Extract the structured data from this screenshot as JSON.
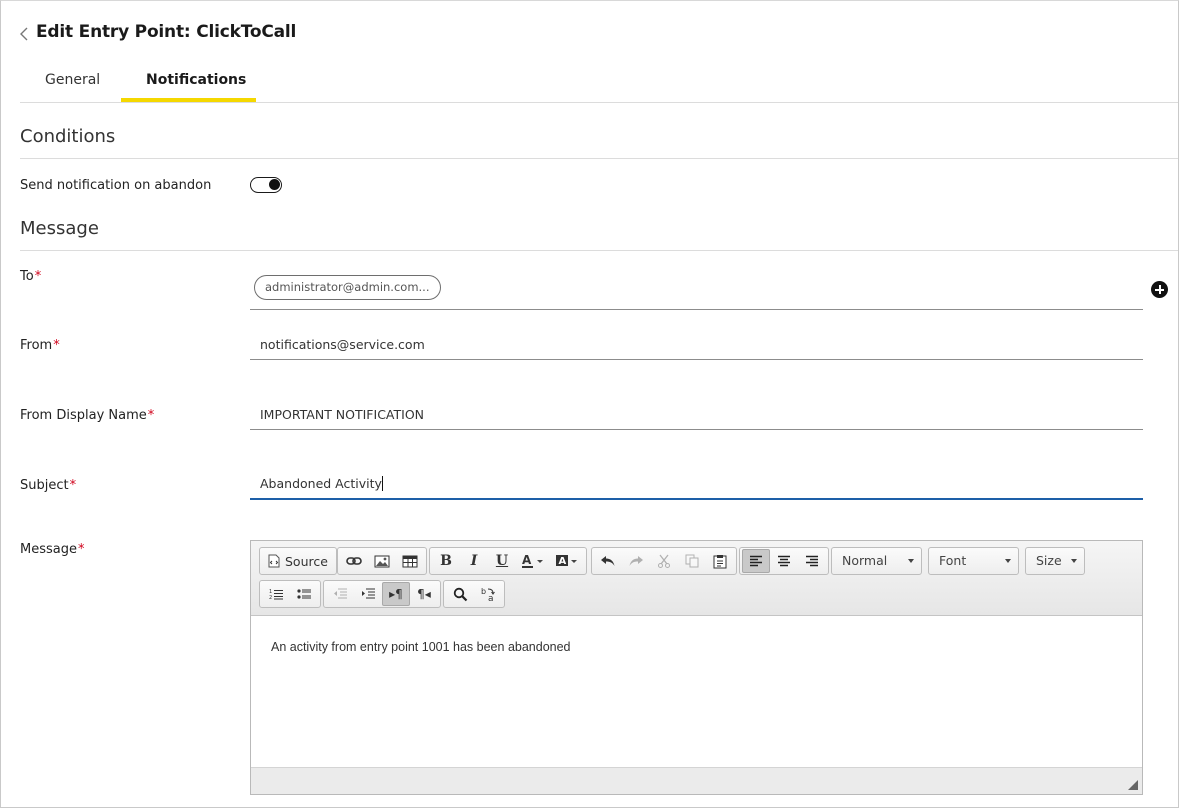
{
  "header": {
    "title": "Edit Entry Point: ClickToCall"
  },
  "tabs": [
    {
      "label": "General",
      "active": false
    },
    {
      "label": "Notifications",
      "active": true
    }
  ],
  "conditions": {
    "title": "Conditions",
    "abandon_label": "Send notification on abandon",
    "abandon_enabled": true
  },
  "message": {
    "title": "Message",
    "to_label": "To",
    "to_chip": "administrator@admin.com...",
    "from_label": "From",
    "from_value": "notifications@service.com",
    "display_name_label": "From Display Name",
    "display_name_value": "IMPORTANT NOTIFICATION",
    "subject_label": "Subject",
    "subject_value": "Abandoned Activity",
    "message_label": "Message",
    "required_marker": "*"
  },
  "editor": {
    "source_label": "Source",
    "format_value": "Normal",
    "font_value": "Font",
    "size_value": "Size",
    "body": "An activity from entry point 1001 has been abandoned",
    "alignment": "left"
  },
  "colors": {
    "tab_accent": "#f5d800",
    "active_field": "#1d5fa8",
    "required": "#d0021b"
  }
}
